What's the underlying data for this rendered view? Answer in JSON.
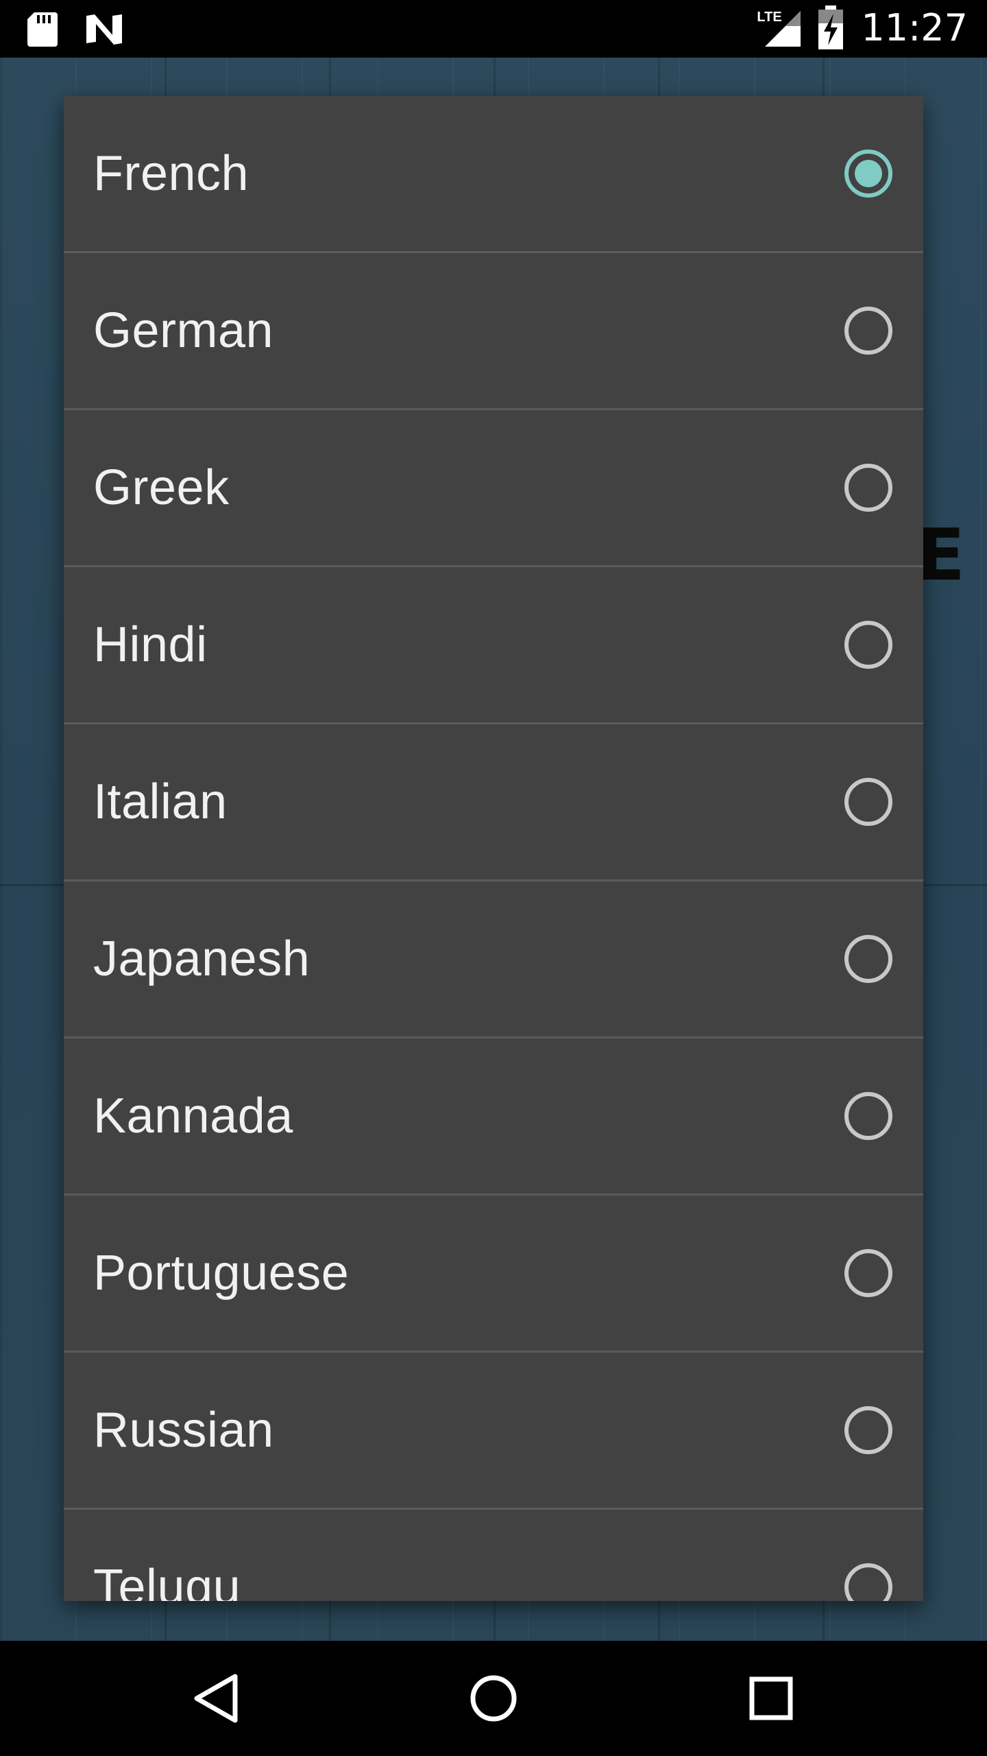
{
  "status_bar": {
    "time": "11:27",
    "network": "LTE",
    "icons": [
      "sd-card-icon",
      "n-notification-icon",
      "signal-icon",
      "battery-charging-icon"
    ]
  },
  "background": {
    "partial_text": "E"
  },
  "language_dialog": {
    "selected": "French",
    "accent_color": "#80cbc4",
    "items": [
      {
        "label": "French",
        "checked": true
      },
      {
        "label": "German",
        "checked": false
      },
      {
        "label": "Greek",
        "checked": false
      },
      {
        "label": "Hindi",
        "checked": false
      },
      {
        "label": "Italian",
        "checked": false
      },
      {
        "label": "Japanesh",
        "checked": false
      },
      {
        "label": "Kannada",
        "checked": false
      },
      {
        "label": "Portuguese",
        "checked": false
      },
      {
        "label": "Russian",
        "checked": false
      },
      {
        "label": "Telugu",
        "checked": false
      }
    ]
  },
  "nav_bar": {
    "buttons": [
      "back-icon",
      "home-icon",
      "recents-icon"
    ]
  }
}
